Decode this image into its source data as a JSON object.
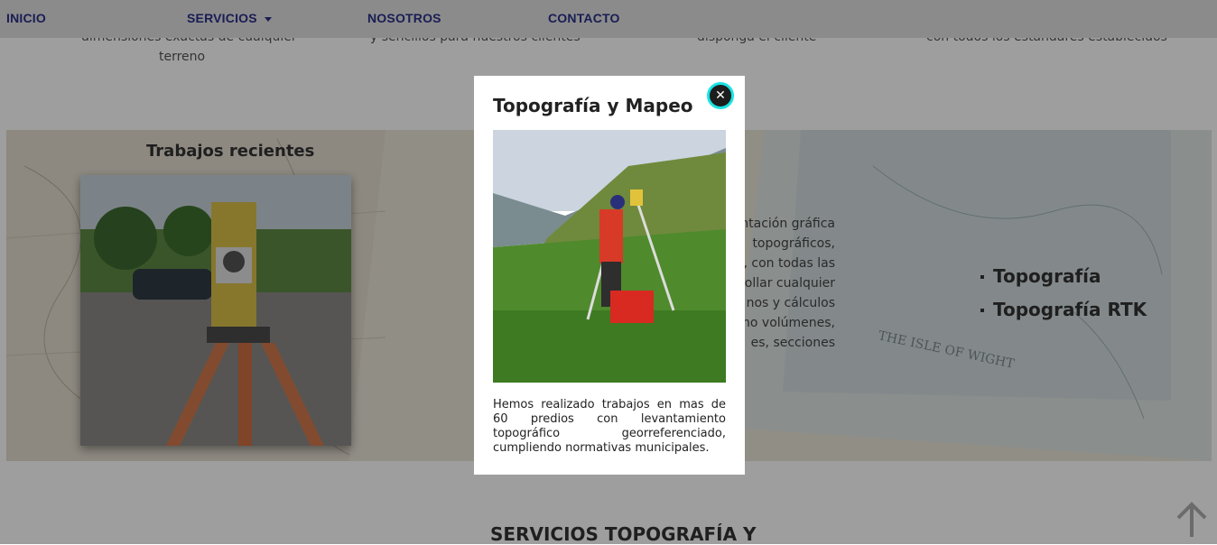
{
  "nav": {
    "items": [
      {
        "label": "INICIO"
      },
      {
        "label": "SERVICIOS"
      },
      {
        "label": "NOSOTROS"
      },
      {
        "label": "CONTACTO"
      }
    ]
  },
  "features": {
    "col1_line1": "dimensiones exactas de cualquier",
    "col1_line2": "terreno",
    "col2_line1": "y sencillos para nuestros clientes",
    "col3_line1": "disponga el cliente",
    "col4_line1": "con todos los estándares establecidos"
  },
  "recent": {
    "title": "Trabajos recientes"
  },
  "description": {
    "lines": [
      "entación gráfica",
      "topográficos,",
      "e, con todas las",
      "rrollar cualquier",
      "nos y cálculos",
      "mo volúmenes,",
      "es, secciones"
    ]
  },
  "services": {
    "items": [
      {
        "label": "Topografía"
      },
      {
        "label": "Topografía RTK"
      }
    ]
  },
  "section": {
    "heading": "SERVICIOS TOPOGRAFÍA Y"
  },
  "modal": {
    "title": "Topografía y Mapeo",
    "close_icon": "close-icon",
    "body": "Hemos realizado trabajos en mas de 60 predios con levantamiento topográfico georreferenciado, cumpliendo normativas municipales."
  },
  "map_text": {
    "label": "THE ISLE OF WIGHT"
  },
  "colors": {
    "nav_text": "#2b2f88",
    "close_ring": "#19e3e3"
  }
}
